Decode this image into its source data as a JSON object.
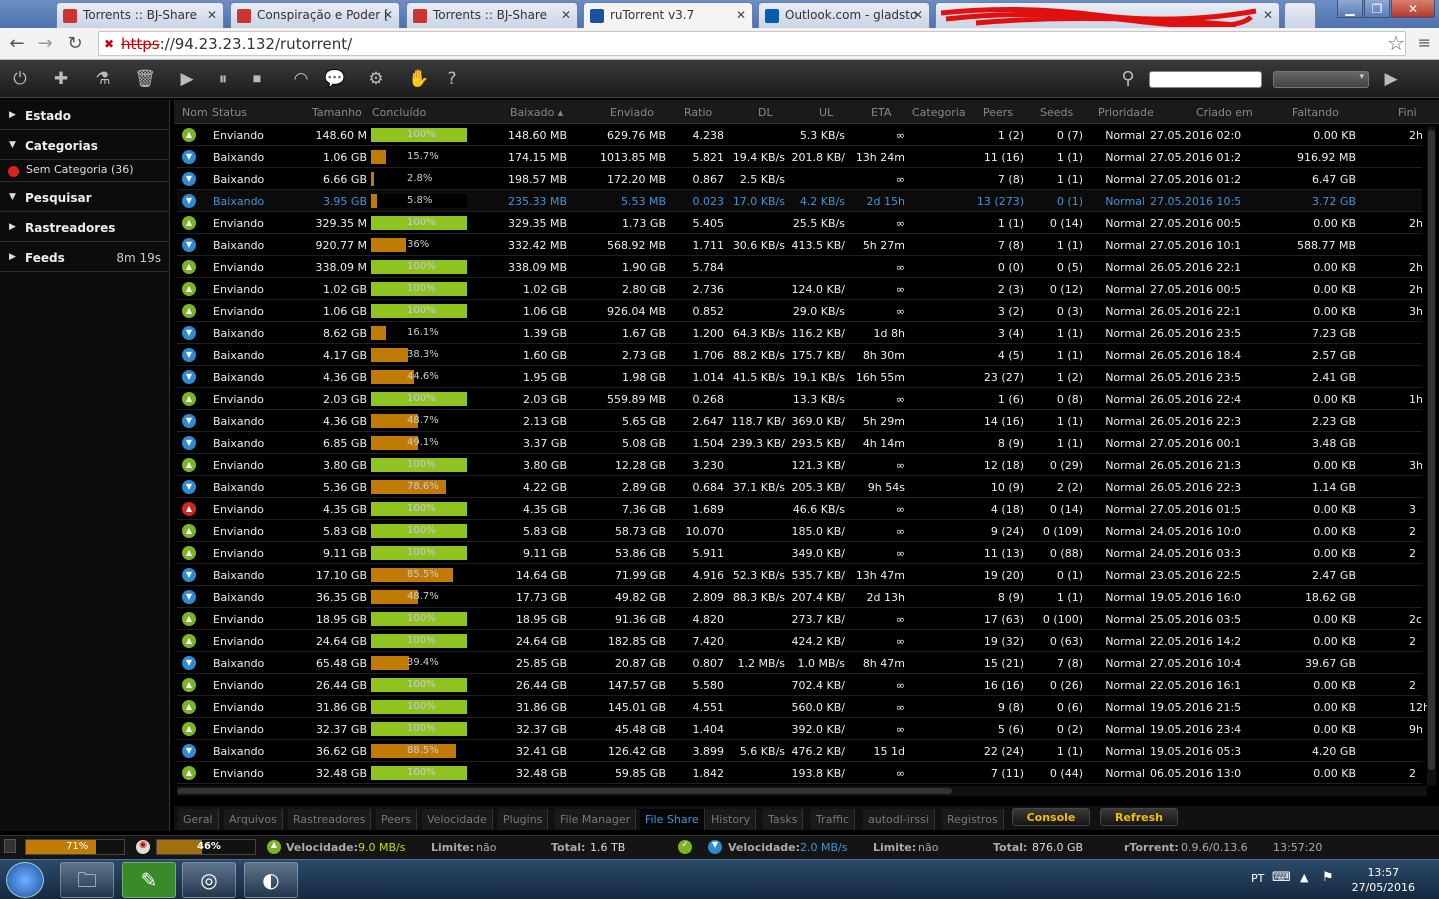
{
  "browser": {
    "tabs": [
      {
        "label": "Torrents :: BJ-Share",
        "active": false
      },
      {
        "label": "Conspiração e Poder [",
        "active": false
      },
      {
        "label": "Torrents :: BJ-Share",
        "active": false
      },
      {
        "label": "ruTorrent v3.7",
        "active": true
      },
      {
        "label": "Outlook.com - gladsto",
        "active": false
      }
    ],
    "url_scheme": "https",
    "url_rest": "://94.23.23.132/rutorrent/"
  },
  "sidebar": {
    "estado": "Estado",
    "categorias": "Categorias",
    "sem_categoria": "Sem Categoria (36)",
    "pesquisar": "Pesquisar",
    "rastreadores": "Rastreadores",
    "feeds": "Feeds",
    "feeds_time": "8m 19s"
  },
  "columns": {
    "nom": "Nom",
    "status": "Status",
    "tamanho": "Tamanho",
    "concluido": "Concluído",
    "baixado": "Baixado ▴",
    "enviado": "Enviado",
    "ratio": "Ratio",
    "dl": "DL",
    "ul": "UL",
    "eta": "ETA",
    "categoria": "Categoria",
    "peers": "Peers",
    "seeds": "Seeds",
    "prioridade": "Prioridade",
    "criado": "Criado em",
    "faltando": "Faltando",
    "fini": "Fini"
  },
  "rows": [
    {
      "st": "up",
      "status": "Enviando",
      "size": "148.60 M",
      "pct": "100%",
      "p": 100,
      "down": "148.60 MB",
      "sent": "629.76 MB",
      "ratio": "4.238",
      "dl": "",
      "ul": "5.3 KB/s",
      "eta": "∞",
      "peers": "1 (2)",
      "seeds": "0 (7)",
      "prio": "Normal",
      "created": "27.05.2016 02:0",
      "left": "0.00 KB",
      "fin": "2h"
    },
    {
      "st": "dn",
      "status": "Baixando",
      "size": "1.06 GB",
      "pct": "15.7%",
      "p": 15.7,
      "down": "174.15 MB",
      "sent": "1013.85 MB",
      "ratio": "5.821",
      "dl": "19.4 KB/s",
      "ul": "201.8 KB/",
      "eta": "13h 24m",
      "peers": "11 (16)",
      "seeds": "1 (1)",
      "prio": "Normal",
      "created": "27.05.2016 01:2",
      "left": "916.92 MB",
      "fin": ""
    },
    {
      "st": "dn",
      "status": "Baixando",
      "size": "6.66 GB",
      "pct": "2.8%",
      "p": 2.8,
      "down": "198.57 MB",
      "sent": "172.20 MB",
      "ratio": "0.867",
      "dl": "2.5 KB/s",
      "ul": "",
      "eta": "∞",
      "peers": "7 (8)",
      "seeds": "1 (1)",
      "prio": "Normal",
      "created": "27.05.2016 01:2",
      "left": "6.47 GB",
      "fin": ""
    },
    {
      "st": "dn",
      "status": "Baixando",
      "size": "3.95 GB",
      "pct": "5.8%",
      "p": 5.8,
      "down": "235.33 MB",
      "sent": "5.53 MB",
      "ratio": "0.023",
      "dl": "17.0 KB/s",
      "ul": "4.2 KB/s",
      "eta": "2d 15h",
      "peers": "13 (273)",
      "seeds": "0 (1)",
      "prio": "Normal",
      "created": "27.05.2016 10:5",
      "left": "3.72 GB",
      "fin": "",
      "sel": true
    },
    {
      "st": "up",
      "status": "Enviando",
      "size": "329.35 M",
      "pct": "100%",
      "p": 100,
      "down": "329.35 MB",
      "sent": "1.73 GB",
      "ratio": "5.405",
      "dl": "",
      "ul": "25.5 KB/s",
      "eta": "∞",
      "peers": "1 (1)",
      "seeds": "0 (14)",
      "prio": "Normal",
      "created": "27.05.2016 00:5",
      "left": "0.00 KB",
      "fin": "2h"
    },
    {
      "st": "dn",
      "status": "Baixando",
      "size": "920.77 M",
      "pct": "36%",
      "p": 36,
      "down": "332.42 MB",
      "sent": "568.92 MB",
      "ratio": "1.711",
      "dl": "30.6 KB/s",
      "ul": "413.5 KB/",
      "eta": "5h 27m",
      "peers": "7 (8)",
      "seeds": "1 (1)",
      "prio": "Normal",
      "created": "27.05.2016 10:1",
      "left": "588.77 MB",
      "fin": ""
    },
    {
      "st": "up",
      "status": "Enviando",
      "size": "338.09 M",
      "pct": "100%",
      "p": 100,
      "down": "338.09 MB",
      "sent": "1.90 GB",
      "ratio": "5.784",
      "dl": "",
      "ul": "",
      "eta": "∞",
      "peers": "0 (0)",
      "seeds": "0 (5)",
      "prio": "Normal",
      "created": "26.05.2016 22:1",
      "left": "0.00 KB",
      "fin": "2h"
    },
    {
      "st": "up",
      "status": "Enviando",
      "size": "1.02 GB",
      "pct": "100%",
      "p": 100,
      "down": "1.02 GB",
      "sent": "2.80 GB",
      "ratio": "2.736",
      "dl": "",
      "ul": "124.0 KB/",
      "eta": "∞",
      "peers": "2 (3)",
      "seeds": "0 (12)",
      "prio": "Normal",
      "created": "27.05.2016 00:5",
      "left": "0.00 KB",
      "fin": "2h"
    },
    {
      "st": "up",
      "status": "Enviando",
      "size": "1.06 GB",
      "pct": "100%",
      "p": 100,
      "down": "1.06 GB",
      "sent": "926.04 MB",
      "ratio": "0.852",
      "dl": "",
      "ul": "29.0 KB/s",
      "eta": "∞",
      "peers": "3 (2)",
      "seeds": "0 (3)",
      "prio": "Normal",
      "created": "26.05.2016 22:1",
      "left": "0.00 KB",
      "fin": "3h"
    },
    {
      "st": "dn",
      "status": "Baixando",
      "size": "8.62 GB",
      "pct": "16.1%",
      "p": 16.1,
      "down": "1.39 GB",
      "sent": "1.67 GB",
      "ratio": "1.200",
      "dl": "64.3 KB/s",
      "ul": "116.2 KB/",
      "eta": "1d 8h",
      "peers": "3 (4)",
      "seeds": "1 (1)",
      "prio": "Normal",
      "created": "26.05.2016 23:5",
      "left": "7.23 GB",
      "fin": ""
    },
    {
      "st": "dn",
      "status": "Baixando",
      "size": "4.17 GB",
      "pct": "38.3%",
      "p": 38.3,
      "down": "1.60 GB",
      "sent": "2.73 GB",
      "ratio": "1.706",
      "dl": "88.2 KB/s",
      "ul": "175.7 KB/",
      "eta": "8h 30m",
      "peers": "4 (5)",
      "seeds": "1 (1)",
      "prio": "Normal",
      "created": "26.05.2016 18:4",
      "left": "2.57 GB",
      "fin": ""
    },
    {
      "st": "dn",
      "status": "Baixando",
      "size": "4.36 GB",
      "pct": "44.6%",
      "p": 44.6,
      "down": "1.95 GB",
      "sent": "1.98 GB",
      "ratio": "1.014",
      "dl": "41.5 KB/s",
      "ul": "19.1 KB/s",
      "eta": "16h 55m",
      "peers": "23 (27)",
      "seeds": "1 (2)",
      "prio": "Normal",
      "created": "26.05.2016 23:5",
      "left": "2.41 GB",
      "fin": ""
    },
    {
      "st": "up",
      "status": "Enviando",
      "size": "2.03 GB",
      "pct": "100%",
      "p": 100,
      "down": "2.03 GB",
      "sent": "559.89 MB",
      "ratio": "0.268",
      "dl": "",
      "ul": "13.3 KB/s",
      "eta": "∞",
      "peers": "1 (6)",
      "seeds": "0 (8)",
      "prio": "Normal",
      "created": "26.05.2016 22:4",
      "left": "0.00 KB",
      "fin": "1h"
    },
    {
      "st": "dn",
      "status": "Baixando",
      "size": "4.36 GB",
      "pct": "48.7%",
      "p": 48.7,
      "down": "2.13 GB",
      "sent": "5.65 GB",
      "ratio": "2.647",
      "dl": "118.7 KB/",
      "ul": "369.0 KB/",
      "eta": "5h 29m",
      "peers": "14 (16)",
      "seeds": "1 (1)",
      "prio": "Normal",
      "created": "26.05.2016 22:3",
      "left": "2.23 GB",
      "fin": ""
    },
    {
      "st": "dn",
      "status": "Baixando",
      "size": "6.85 GB",
      "pct": "49.1%",
      "p": 49.1,
      "down": "3.37 GB",
      "sent": "5.08 GB",
      "ratio": "1.504",
      "dl": "239.3 KB/",
      "ul": "293.5 KB/",
      "eta": "4h 14m",
      "peers": "8 (9)",
      "seeds": "1 (1)",
      "prio": "Normal",
      "created": "27.05.2016 00:1",
      "left": "3.48 GB",
      "fin": ""
    },
    {
      "st": "up",
      "status": "Enviando",
      "size": "3.80 GB",
      "pct": "100%",
      "p": 100,
      "down": "3.80 GB",
      "sent": "12.28 GB",
      "ratio": "3.230",
      "dl": "",
      "ul": "121.3 KB/",
      "eta": "∞",
      "peers": "12 (18)",
      "seeds": "0 (29)",
      "prio": "Normal",
      "created": "26.05.2016 21:3",
      "left": "0.00 KB",
      "fin": "3h"
    },
    {
      "st": "dn",
      "status": "Baixando",
      "size": "5.36 GB",
      "pct": "78.6%",
      "p": 78.6,
      "down": "4.22 GB",
      "sent": "2.89 GB",
      "ratio": "0.684",
      "dl": "37.1 KB/s",
      "ul": "205.3 KB/",
      "eta": "9h 54s",
      "peers": "10 (9)",
      "seeds": "2 (2)",
      "prio": "Normal",
      "created": "26.05.2016 22:3",
      "left": "1.14 GB",
      "fin": ""
    },
    {
      "st": "er",
      "status": "Enviando",
      "size": "4.35 GB",
      "pct": "100%",
      "p": 100,
      "down": "4.35 GB",
      "sent": "7.36 GB",
      "ratio": "1.689",
      "dl": "",
      "ul": "46.6 KB/s",
      "eta": "∞",
      "peers": "4 (18)",
      "seeds": "0 (14)",
      "prio": "Normal",
      "created": "27.05.2016 01:5",
      "left": "0.00 KB",
      "fin": "3"
    },
    {
      "st": "up",
      "status": "Enviando",
      "size": "5.83 GB",
      "pct": "100%",
      "p": 100,
      "down": "5.83 GB",
      "sent": "58.73 GB",
      "ratio": "10.070",
      "dl": "",
      "ul": "185.0 KB/",
      "eta": "∞",
      "peers": "9 (24)",
      "seeds": "0 (109)",
      "prio": "Normal",
      "created": "24.05.2016 10:0",
      "left": "0.00 KB",
      "fin": "2"
    },
    {
      "st": "up",
      "status": "Enviando",
      "size": "9.11 GB",
      "pct": "100%",
      "p": 100,
      "down": "9.11 GB",
      "sent": "53.86 GB",
      "ratio": "5.911",
      "dl": "",
      "ul": "349.0 KB/",
      "eta": "∞",
      "peers": "11 (13)",
      "seeds": "0 (88)",
      "prio": "Normal",
      "created": "24.05.2016 03:3",
      "left": "0.00 KB",
      "fin": "2"
    },
    {
      "st": "dn",
      "status": "Baixando",
      "size": "17.10 GB",
      "pct": "85.5%",
      "p": 85.5,
      "down": "14.64 GB",
      "sent": "71.99 GB",
      "ratio": "4.916",
      "dl": "52.3 KB/s",
      "ul": "535.7 KB/",
      "eta": "13h 47m",
      "peers": "19 (20)",
      "seeds": "0 (1)",
      "prio": "Normal",
      "created": "23.05.2016 22:5",
      "left": "2.47 GB",
      "fin": ""
    },
    {
      "st": "dn",
      "status": "Baixando",
      "size": "36.35 GB",
      "pct": "48.7%",
      "p": 48.7,
      "down": "17.73 GB",
      "sent": "49.82 GB",
      "ratio": "2.809",
      "dl": "88.3 KB/s",
      "ul": "207.4 KB/",
      "eta": "2d 13h",
      "peers": "8 (9)",
      "seeds": "1 (1)",
      "prio": "Normal",
      "created": "19.05.2016 16:0",
      "left": "18.62 GB",
      "fin": ""
    },
    {
      "st": "up",
      "status": "Enviando",
      "size": "18.95 GB",
      "pct": "100%",
      "p": 100,
      "down": "18.95 GB",
      "sent": "91.36 GB",
      "ratio": "4.820",
      "dl": "",
      "ul": "273.7 KB/",
      "eta": "∞",
      "peers": "17 (63)",
      "seeds": "0 (100)",
      "prio": "Normal",
      "created": "25.05.2016 03:5",
      "left": "0.00 KB",
      "fin": "2c"
    },
    {
      "st": "up",
      "status": "Enviando",
      "size": "24.64 GB",
      "pct": "100%",
      "p": 100,
      "down": "24.64 GB",
      "sent": "182.85 GB",
      "ratio": "7.420",
      "dl": "",
      "ul": "424.2 KB/",
      "eta": "∞",
      "peers": "19 (32)",
      "seeds": "0 (63)",
      "prio": "Normal",
      "created": "22.05.2016 14:2",
      "left": "0.00 KB",
      "fin": "2"
    },
    {
      "st": "dn",
      "status": "Baixando",
      "size": "65.48 GB",
      "pct": "39.4%",
      "p": 39.4,
      "down": "25.85 GB",
      "sent": "20.87 GB",
      "ratio": "0.807",
      "dl": "1.2 MB/s",
      "ul": "1.0 MB/s",
      "eta": "8h 47m",
      "peers": "15 (21)",
      "seeds": "7 (8)",
      "prio": "Normal",
      "created": "27.05.2016 10:4",
      "left": "39.67 GB",
      "fin": ""
    },
    {
      "st": "up",
      "status": "Enviando",
      "size": "26.44 GB",
      "pct": "100%",
      "p": 100,
      "down": "26.44 GB",
      "sent": "147.57 GB",
      "ratio": "5.580",
      "dl": "",
      "ul": "702.4 KB/",
      "eta": "∞",
      "peers": "16 (16)",
      "seeds": "0 (26)",
      "prio": "Normal",
      "created": "22.05.2016 16:1",
      "left": "0.00 KB",
      "fin": "2"
    },
    {
      "st": "up",
      "status": "Enviando",
      "size": "31.86 GB",
      "pct": "100%",
      "p": 100,
      "down": "31.86 GB",
      "sent": "145.01 GB",
      "ratio": "4.551",
      "dl": "",
      "ul": "560.0 KB/",
      "eta": "∞",
      "peers": "9 (8)",
      "seeds": "0 (6)",
      "prio": "Normal",
      "created": "19.05.2016 21:5",
      "left": "0.00 KB",
      "fin": "12h"
    },
    {
      "st": "up",
      "status": "Enviando",
      "size": "32.37 GB",
      "pct": "100%",
      "p": 100,
      "down": "32.37 GB",
      "sent": "45.48 GB",
      "ratio": "1.404",
      "dl": "",
      "ul": "392.0 KB/",
      "eta": "∞",
      "peers": "5 (6)",
      "seeds": "0 (2)",
      "prio": "Normal",
      "created": "19.05.2016 23:4",
      "left": "0.00 KB",
      "fin": "9h"
    },
    {
      "st": "dn",
      "status": "Baixando",
      "size": "36.62 GB",
      "pct": "88.5%",
      "p": 88.5,
      "down": "32.41 GB",
      "sent": "126.42 GB",
      "ratio": "3.899",
      "dl": "5.6 KB/s",
      "ul": "476.2 KB/",
      "eta": "15 1d",
      "peers": "22 (24)",
      "seeds": "1 (1)",
      "prio": "Normal",
      "created": "19.05.2016 05:3",
      "left": "4.20 GB",
      "fin": ""
    },
    {
      "st": "up",
      "status": "Enviando",
      "size": "32.48 GB",
      "pct": "100%",
      "p": 100,
      "down": "32.48 GB",
      "sent": "59.85 GB",
      "ratio": "1.842",
      "dl": "",
      "ul": "193.8 KB/",
      "eta": "∞",
      "peers": "7 (11)",
      "seeds": "0 (44)",
      "prio": "Normal",
      "created": "06.05.2016 13:0",
      "left": "0.00 KB",
      "fin": "2"
    }
  ],
  "tabs": [
    "Geral",
    "Arquivos",
    "Rastreadores",
    "Peers",
    "Velocidade",
    "Plugins",
    "File Manager",
    "File Share",
    "History",
    "Tasks",
    "Traffic",
    "autodl-irssi",
    "Registros"
  ],
  "active_tab": "File Share",
  "console_label": "Console",
  "refresh_label": "Refresh",
  "status": {
    "disk1": "71%",
    "disk2": "46%",
    "up_label": "Velocidade:",
    "up_speed": "9.0 MB/s",
    "up_limit_label": "Limite:",
    "up_limit": "não",
    "up_total_label": "Total:",
    "up_total": "1.6 TB",
    "dn_label": "Velocidade:",
    "dn_speed": "2.0 MB/s",
    "dn_limit_label": "Limite:",
    "dn_limit": "não",
    "dn_total_label": "Total:",
    "dn_total": "876.0 GB",
    "version_label": "rTorrent:",
    "version": "0.9.6/0.13.6",
    "time": "13:57:20"
  },
  "taskbar": {
    "lang": "PT",
    "time": "13:57",
    "date": "27/05/2016"
  },
  "colors": {
    "complete": "#8fc31f",
    "partial": "#c07a06",
    "selected_text": "#3f95d4"
  }
}
